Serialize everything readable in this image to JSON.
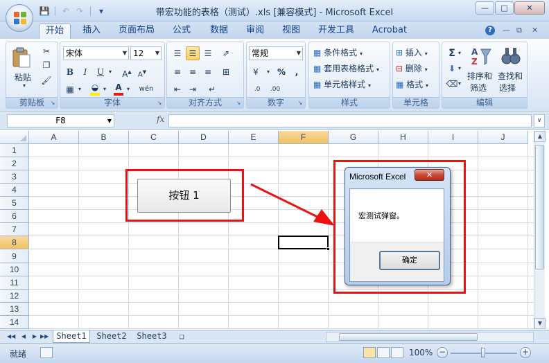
{
  "window": {
    "title": "带宏功能的表格（测试）.xls  [兼容模式] - Microsoft Excel"
  },
  "ribbon": {
    "tabs": [
      "开始",
      "插入",
      "页面布局",
      "公式",
      "数据",
      "审阅",
      "视图",
      "开发工具",
      "Acrobat"
    ],
    "active_tab": "开始",
    "clipboard": {
      "paste": "粘贴",
      "label": "剪贴板"
    },
    "font": {
      "name": "宋体",
      "size": "12",
      "label": "字体"
    },
    "alignment": {
      "label": "对齐方式"
    },
    "number": {
      "format": "常规",
      "label": "数字"
    },
    "styles": {
      "conditional": "条件格式",
      "table": "套用表格格式",
      "cell": "单元格样式",
      "label": "样式"
    },
    "cells": {
      "insert": "插入",
      "delete": "删除",
      "format": "格式",
      "label": "单元格"
    },
    "editing": {
      "sort": "排序和",
      "sort2": "筛选",
      "find": "查找和",
      "find2": "选择",
      "label": "编辑"
    }
  },
  "formula_bar": {
    "name_box": "F8",
    "fx": "fx",
    "value": ""
  },
  "grid": {
    "columns": [
      "A",
      "B",
      "C",
      "D",
      "E",
      "F",
      "G",
      "H",
      "I",
      "J"
    ],
    "rows": [
      "1",
      "2",
      "3",
      "4",
      "5",
      "6",
      "7",
      "8",
      "9",
      "10",
      "11",
      "12",
      "13",
      "14"
    ],
    "selected_col": "F",
    "selected_row": "8"
  },
  "form_button": {
    "label": "按钮 1"
  },
  "message_box": {
    "title": "Microsoft Excel",
    "text": "宏测试弹窗。",
    "ok_label": "确定"
  },
  "sheets": [
    "Sheet1",
    "Sheet2",
    "Sheet3"
  ],
  "active_sheet": "Sheet1",
  "status": {
    "ready": "就绪",
    "zoom": "100%"
  },
  "colors": {
    "highlight_red": "#ee1111",
    "selected_header": "#f1c15f",
    "ribbon_blue": "#15428b"
  }
}
